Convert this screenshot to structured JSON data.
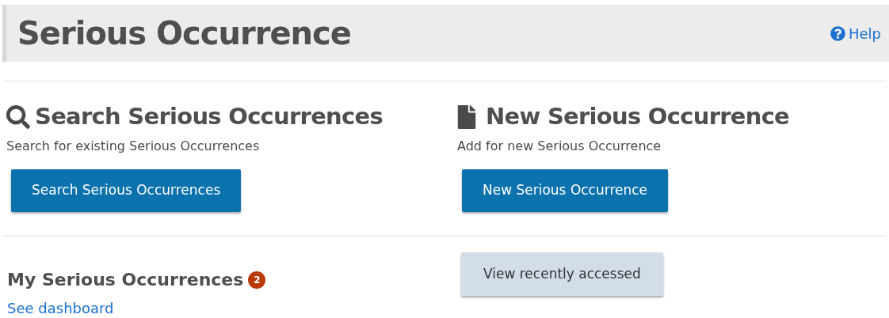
{
  "header": {
    "title": "Serious Occurrence",
    "help_link": "Help"
  },
  "sections": [
    {
      "kind": "search",
      "heading": "Search Serious Occurrences",
      "description": "Search for existing Serious Occurrences",
      "button": "Search Serious Occurrences"
    },
    {
      "kind": "new",
      "heading": "New Serious Occurrence",
      "description": "Add for new Serious Occurrence",
      "button": "New Serious Occurrence"
    }
  ],
  "my_occurrences": {
    "heading": "My Serious Occurrences",
    "badge": "2",
    "link": "See dashboard",
    "button": "View recently accessed"
  }
}
